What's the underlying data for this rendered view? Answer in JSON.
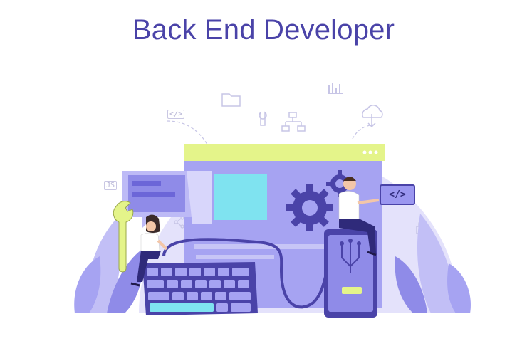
{
  "title": "Back End Developer",
  "code_badge": "</>",
  "small_code_icon": "</>",
  "js_icon": "JS",
  "colors": {
    "title": "#4a43a8",
    "circle": "#e4e2fb",
    "screen": "#a6a3f2",
    "accent_green": "#e4f48a",
    "accent_cyan": "#7fe3f0",
    "dark": "#2f2a7a"
  },
  "icons": [
    "folder-icon",
    "bar-chart-icon",
    "code-icon",
    "wrench-icon",
    "hierarchy-icon",
    "cloud-download-icon",
    "js-file-icon",
    "gear-icon",
    "lock-icon",
    "share-icon"
  ]
}
